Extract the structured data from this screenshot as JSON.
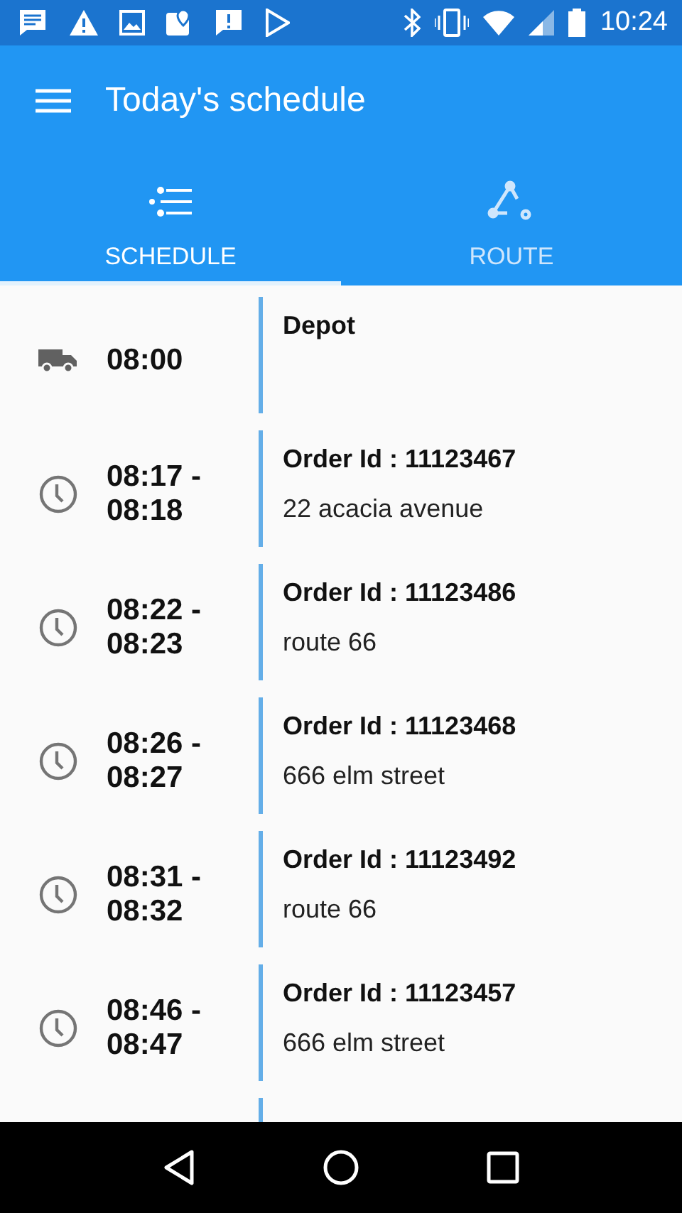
{
  "status_bar": {
    "time": "10:24"
  },
  "toolbar": {
    "title": "Today's schedule"
  },
  "tabs": [
    {
      "label": "SCHEDULE",
      "kind": "schedule",
      "selected": true
    },
    {
      "label": "ROUTE",
      "kind": "route",
      "selected": false
    }
  ],
  "schedule": [
    {
      "kind": "depot",
      "time": "08:00",
      "title": "Depot"
    },
    {
      "kind": "stop",
      "time": "08:17 - 08:18",
      "title": "Order Id : 11123467",
      "address": "22 acacia avenue"
    },
    {
      "kind": "stop",
      "time": "08:22 - 08:23",
      "title": "Order Id : 11123486",
      "address": "route 66"
    },
    {
      "kind": "stop",
      "time": "08:26 - 08:27",
      "title": "Order Id : 11123468",
      "address": "666 elm street"
    },
    {
      "kind": "stop",
      "time": "08:31 - 08:32",
      "title": "Order Id : 11123492",
      "address": "route 66"
    },
    {
      "kind": "stop",
      "time": "08:46 - 08:47",
      "title": "Order Id : 11123457",
      "address": "666 elm street"
    }
  ]
}
